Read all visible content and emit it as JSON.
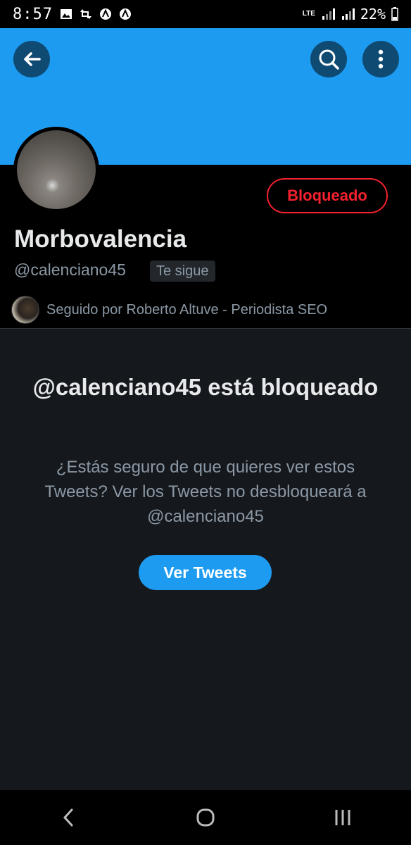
{
  "status_bar": {
    "time": "8:57",
    "network": "LTE",
    "battery": "22%"
  },
  "header": {
    "back_icon": "arrow-left-icon",
    "search_icon": "search-icon",
    "more_icon": "more-vertical-icon",
    "banner_color": "#1d9bf0"
  },
  "profile": {
    "name": "Morbovalencia",
    "handle": "@calenciano45",
    "follows_you": "Te sigue",
    "blocked_label": "Bloqueado",
    "followed_by": "Seguido por Roberto Altuve - Periodista SEO"
  },
  "blocked_notice": {
    "title": "@calenciano45 está bloqueado",
    "description": "¿Estás seguro de que quieres ver estos Tweets? Ver los Tweets no desbloqueará a @calenciano45",
    "view_button": "Ver Tweets"
  },
  "colors": {
    "accent": "#1d9bf0",
    "danger": "#f4212e",
    "background": "#15181c"
  }
}
